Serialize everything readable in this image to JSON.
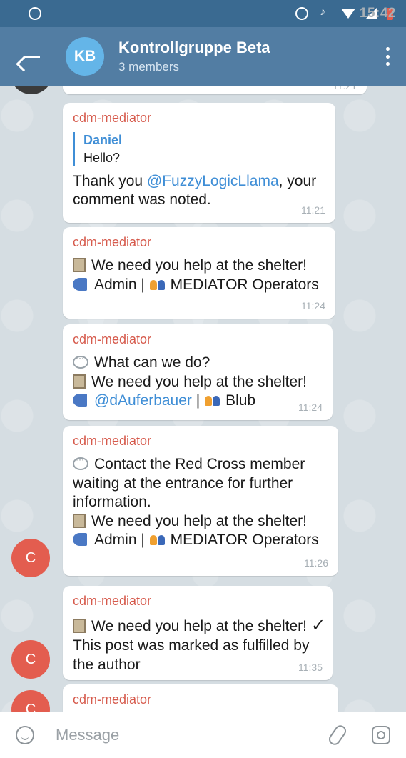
{
  "status_bar": {
    "time": "15:42"
  },
  "header": {
    "avatar_initials": "KB",
    "title": "Kontrollgruppe Beta",
    "subtitle": "3 members"
  },
  "top_partial": {
    "time": "11:21"
  },
  "messages": [
    {
      "sender": "cdm-mediator",
      "quote_name": "Daniel",
      "quote_text": "Hello?",
      "text_pre": "Thank you ",
      "mention": "@FuzzyLogicLlama",
      "text_post": ", your",
      "text_line2": "comment was noted.",
      "time": "11:21"
    },
    {
      "sender": "cdm-mediator",
      "line1": "We need you help at the shelter!",
      "line2a": "Admin  |",
      "line2b": "MEDIATOR Operators",
      "time": "11:24"
    },
    {
      "sender": "cdm-mediator",
      "line1": "What can we do?",
      "line2": "We need you help at the shelter!",
      "mention": "@dAuferbauer",
      "line3b": "|",
      "line3c": "Blub",
      "time": "11:24"
    },
    {
      "sender": "cdm-mediator",
      "line1": "Contact the Red Cross member",
      "line2": "waiting at the entrance for further",
      "line3": "information.",
      "line4": "We need you help at the shelter!",
      "line5a": "Admin  |",
      "line5b": "MEDIATOR Operators",
      "time": "11:26"
    },
    {
      "sender": "cdm-mediator",
      "line1": "We need you help at the shelter!",
      "line2": "This post was marked as fulfilled by",
      "line3": "the author",
      "time": "11:35"
    },
    {
      "sender": "cdm-mediator"
    }
  ],
  "avatar_initial": "C",
  "input": {
    "placeholder": "Message"
  }
}
